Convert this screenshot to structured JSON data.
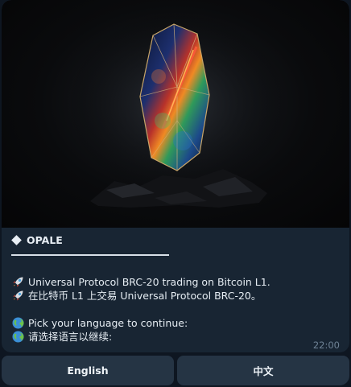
{
  "message": {
    "title": "OPALE",
    "lines": [
      {
        "icon": "rocket-icon",
        "text": "Universal Protocol BRC-20 trading on Bitcoin L1."
      },
      {
        "icon": "rocket-icon",
        "text": "在比特币 L1 上交易 Universal Protocol BRC-20。"
      },
      {
        "icon": "globe-icon",
        "text": "Pick your language to continue:"
      },
      {
        "icon": "globe-icon",
        "text": "请选择语言以继续:"
      }
    ],
    "time": "22:00"
  },
  "buttons": {
    "english": "English",
    "chinese": "中文"
  },
  "colors": {
    "bubble": "#182533",
    "background": "#0e1621",
    "button": "#253444",
    "timestamp": "#6e8295"
  }
}
